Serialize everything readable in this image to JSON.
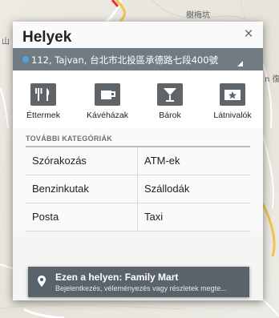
{
  "map": {
    "labels": [
      "樹梅坑",
      "山",
      "n 復"
    ],
    "road_color": "#ffffff",
    "highway_color": "#f2c24f"
  },
  "dialog": {
    "title": "Helyek",
    "close_symbol": "×",
    "location": "112, Tajvan, 台北市北投區承德路七段400號",
    "categories": [
      {
        "label": "Éttermek",
        "icon": "restaurant-icon"
      },
      {
        "label": "Kávéházak",
        "icon": "coffee-icon"
      },
      {
        "label": "Bárok",
        "icon": "bar-icon"
      },
      {
        "label": "Látnivalók",
        "icon": "attractions-icon"
      }
    ],
    "more_heading": "TOVÁBBI KATEGÓRIÁK",
    "more": [
      [
        "Szórakozás",
        "ATM-ek"
      ],
      [
        "Benzinkutak",
        "Szállodák"
      ],
      [
        "Posta",
        "Taxi"
      ]
    ]
  },
  "toast": {
    "title": "Ezen a helyen: Family Mart",
    "subtitle": "Bejelentkezés, véleményezés vagy részletek megte..."
  },
  "colors": {
    "location_bar": "#707b82",
    "accent_pin": "#4aa6e0",
    "toast_bg": "#525b62"
  }
}
